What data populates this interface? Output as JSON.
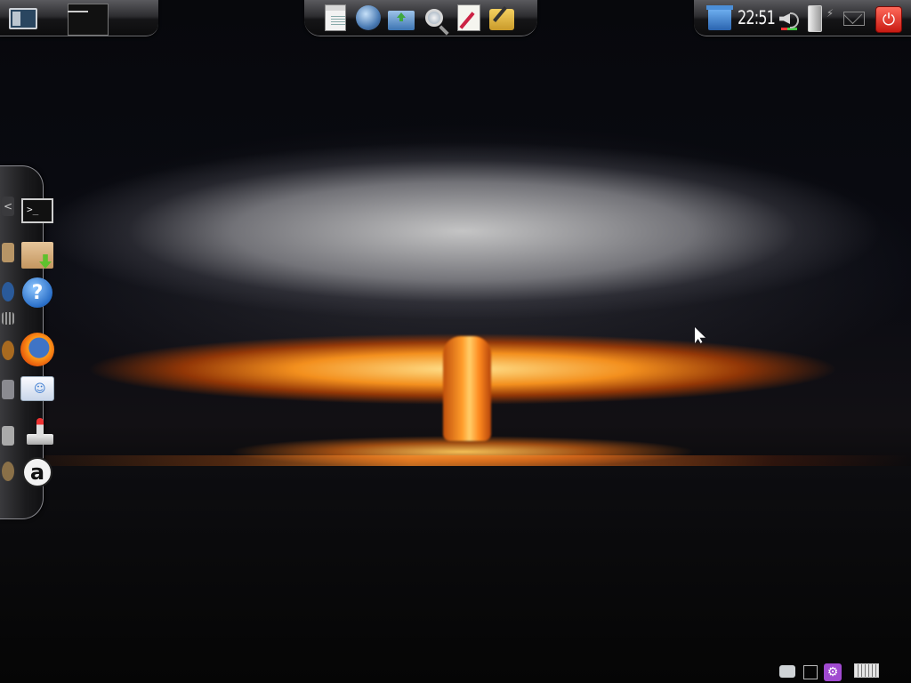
{
  "desktop": {
    "wallpaper": "mushroom-cloud-wallpaper",
    "accent_colors": {
      "panel": "#1a1a1c",
      "power": "#d42a1e",
      "help": "#2a6fc8"
    }
  },
  "top_panel": {
    "left": {
      "show_desktop_icon": "show-desktop-icon",
      "workspace_switcher_icon": "workspace-switcher-icon",
      "workspace_number": "1"
    },
    "center_launchers": [
      {
        "name": "document-viewer-icon"
      },
      {
        "name": "update-manager-icon"
      },
      {
        "name": "file-manager-icon"
      },
      {
        "name": "search-icon"
      },
      {
        "name": "text-editor-icon"
      },
      {
        "name": "drawing-icon"
      }
    ],
    "tray": {
      "trash_icon": "trash-icon",
      "clock": "22:51",
      "volume_icon": "volume-icon",
      "battery_icon": "battery-icon",
      "mail_icon": "mail-icon",
      "power_icon": "power-icon",
      "power_glyph": "⏻"
    }
  },
  "dock": {
    "prev_arrow": "<",
    "items": [
      {
        "name": "terminal-icon",
        "label": ">_"
      },
      {
        "name": "package-installer-icon",
        "label": ""
      },
      {
        "name": "help-icon",
        "label": "?"
      },
      {
        "name": "firefox-icon",
        "label": ""
      },
      {
        "name": "messenger-icon",
        "label": ""
      },
      {
        "name": "games-icon",
        "label": ""
      },
      {
        "name": "amazon-icon",
        "label": "a"
      }
    ]
  },
  "bottom_tray": {
    "icons": [
      "chat-icon",
      "notes-icon",
      "settings-icon",
      "keyboard-icon"
    ],
    "settings_glyph": "⚙"
  }
}
